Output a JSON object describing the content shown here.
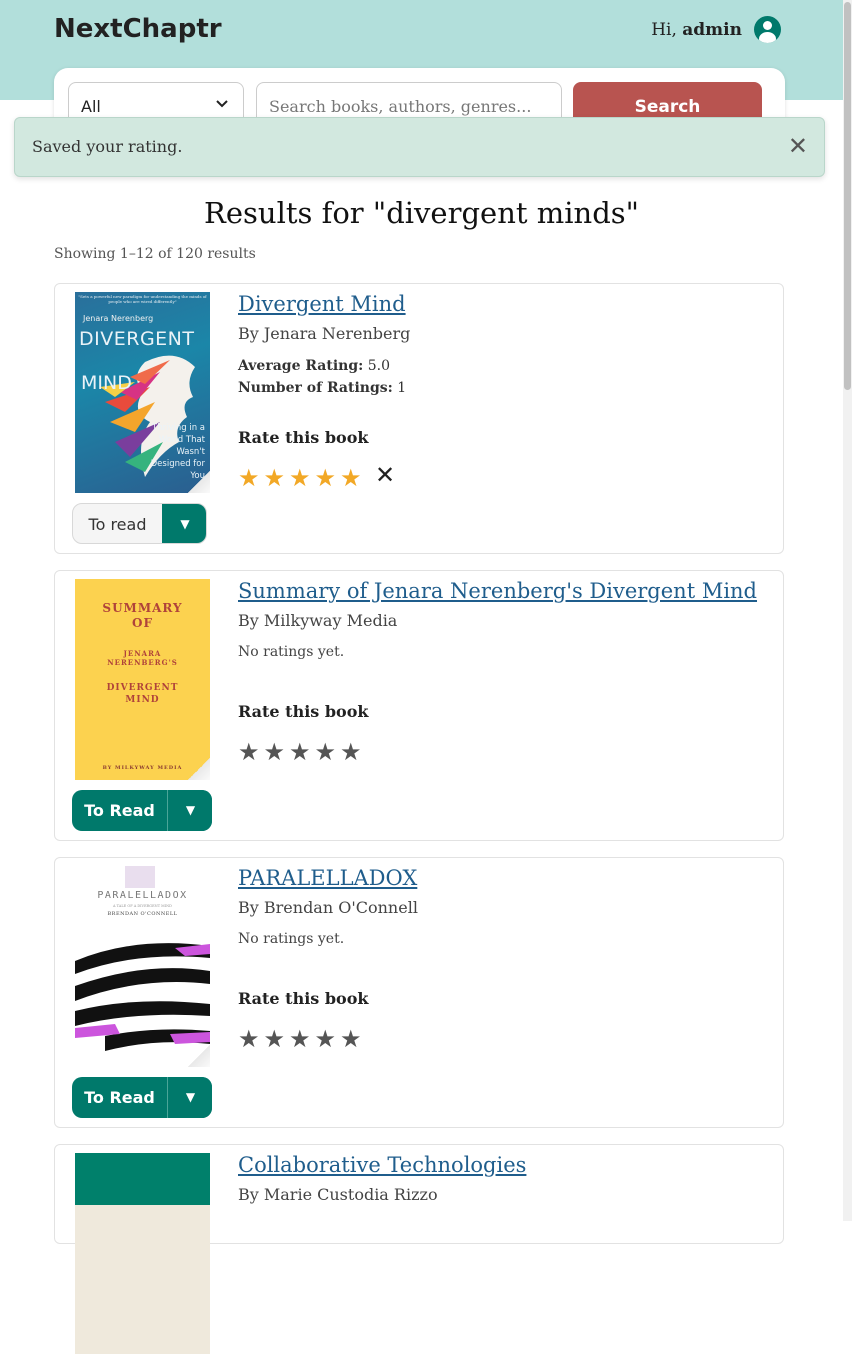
{
  "header": {
    "brand": "NextChaptr",
    "greeting_prefix": "Hi,",
    "username": "admin",
    "header_color": "#b2dfdb"
  },
  "search": {
    "category_value": "All",
    "placeholder": "Search books, authors, genres...",
    "button_label": "Search"
  },
  "toast": {
    "message": "Saved your rating.",
    "close_glyph": "✕"
  },
  "results": {
    "title": "Results for \"divergent minds\"",
    "count_text": "Showing 1–12 of 120 results"
  },
  "labels": {
    "avg_rating": "Average Rating:",
    "num_ratings": "Number of Ratings:",
    "rate_this": "Rate this book",
    "no_ratings": "No ratings yet."
  },
  "books": [
    {
      "title": "Divergent Mind",
      "author": "By Jenara Nerenberg",
      "avg_rating": "5.0",
      "num_ratings": "1",
      "user_rating": 5,
      "shelf_label": "To read",
      "cover": {
        "author": "Jenara Nerenberg",
        "title_line1": "DIVERGENT",
        "title_line2": "MIND",
        "subtitle": "Thriving in a World That Wasn't Designed for You",
        "blurb": "\"Sets a powerful new paradigm for understanding the minds of people who are wired differently\""
      }
    },
    {
      "title": "Summary of Jenara Nerenberg's Divergent Mind",
      "author": "By Milkyway Media",
      "user_rating": 0,
      "shelf_label": "To Read",
      "cover": {
        "line1": "SUMMARY",
        "line2": "OF",
        "line3": "JENARA",
        "line4": "NERENBERG'S",
        "line5": "DIVERGENT",
        "line6": "MIND",
        "publisher": "BY MILKYWAY MEDIA"
      }
    },
    {
      "title": "PARALELLADOX",
      "author": "By Brendan O'Connell",
      "user_rating": 0,
      "shelf_label": "To Read",
      "cover": {
        "title": "PARALELLADOX",
        "tagline": "A TALE OF A DIVERGENT MIND",
        "author": "BRENDAN O'CONNELL"
      }
    },
    {
      "title": "Collaborative Technologies",
      "author": "By Marie Custodia Rizzo"
    }
  ],
  "colors": {
    "accent_teal": "#00796b",
    "search_button": "#b85450",
    "link_blue": "#1f5d8c",
    "star_gold": "#f2a826",
    "toast_bg": "#d2e8df"
  }
}
